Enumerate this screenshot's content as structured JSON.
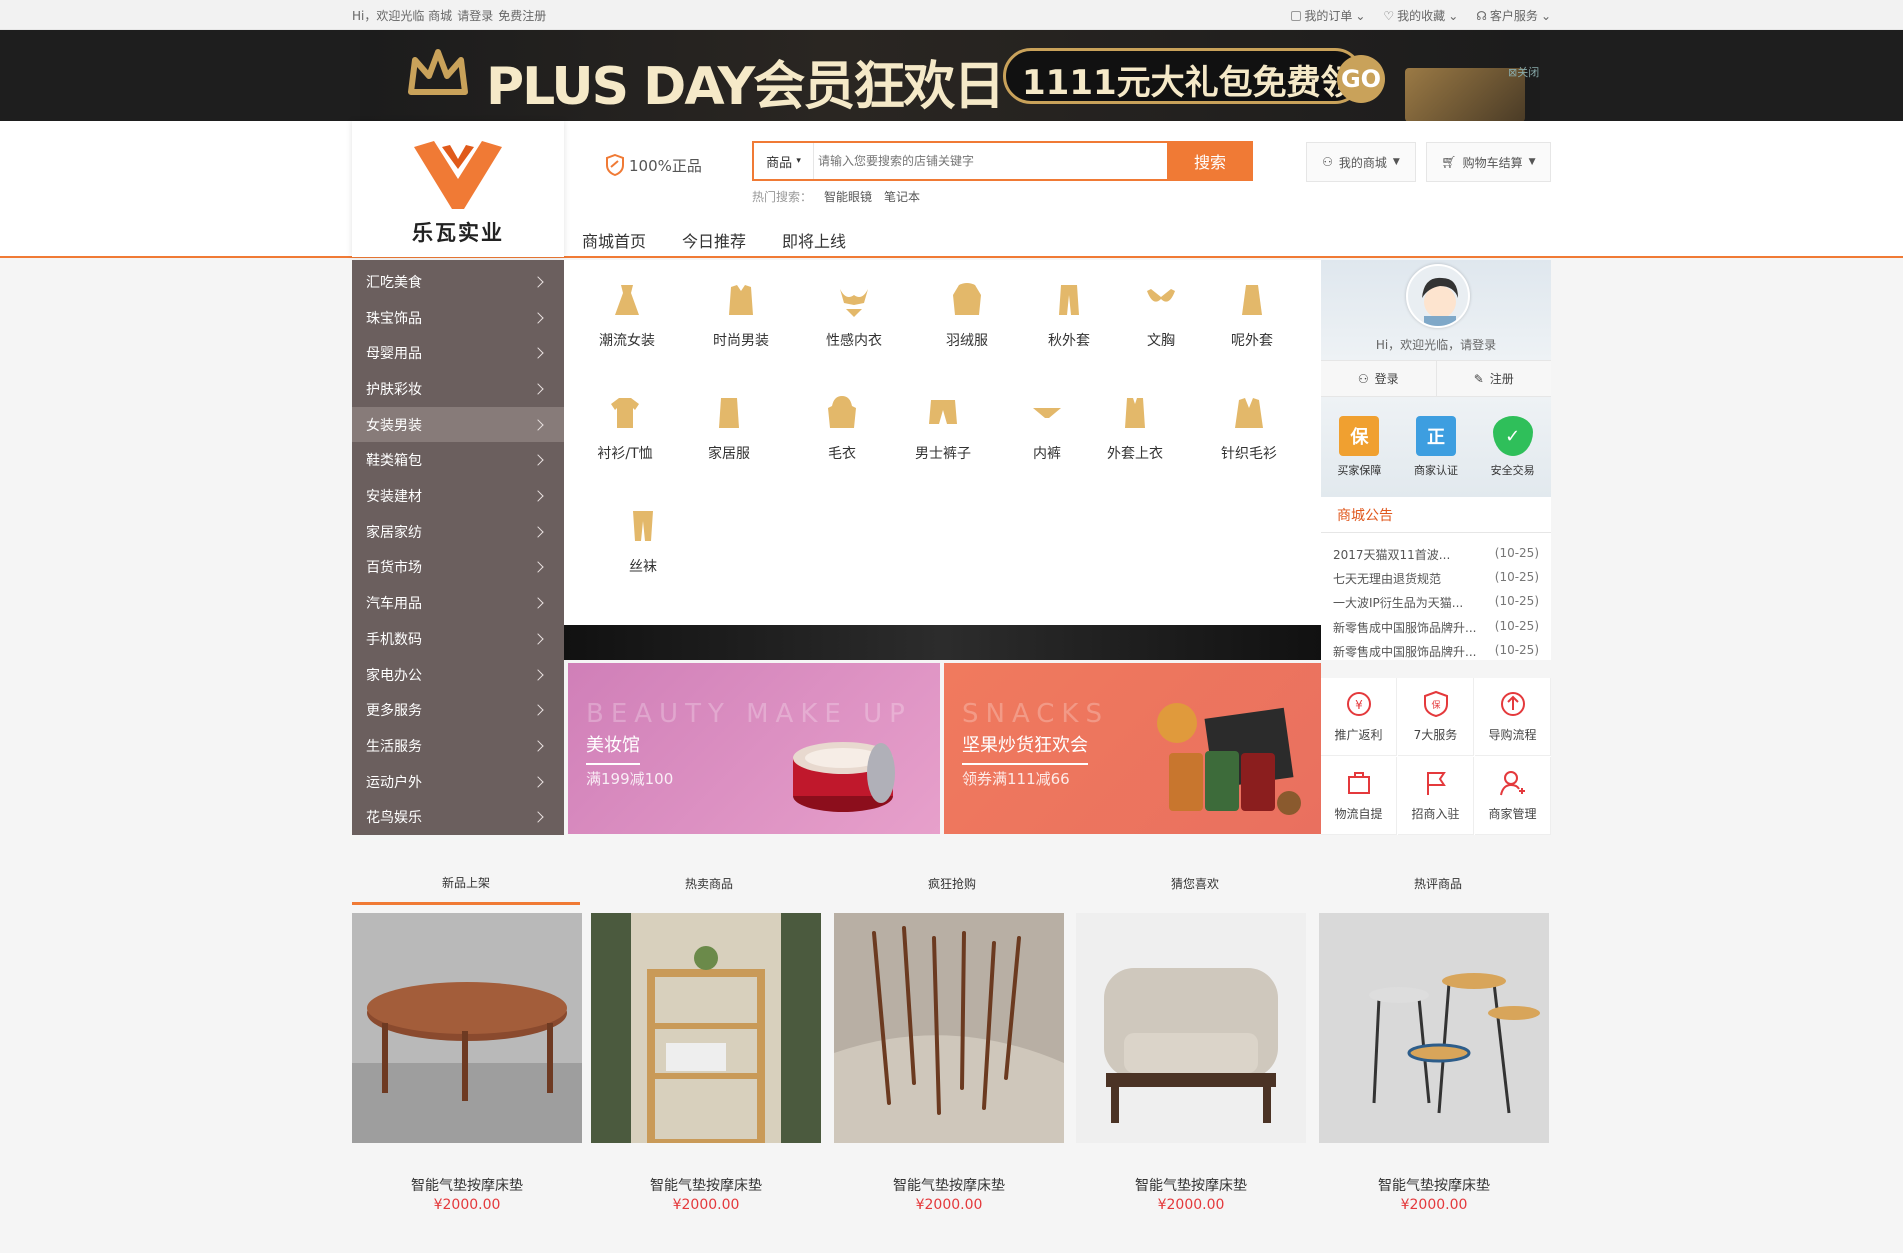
{
  "topbar": {
    "greeting": "Hi，欢迎光临 商城",
    "login": "请登录",
    "register": "免费注册",
    "my_orders": "我的订单",
    "my_favorites": "我的收藏",
    "customer_service": "客户服务"
  },
  "banner": {
    "headline": "PLUS DAY会员狂欢日",
    "offer": "1111元大礼包免费领",
    "go": "GO",
    "close": "关闭"
  },
  "logo": {
    "name": "乐瓦实业"
  },
  "header": {
    "genuine": "100%正品",
    "search_category": "商品",
    "search_placeholder": "请输入您要搜索的店铺关键字",
    "search_button": "搜索",
    "hot_label": "热门搜索：",
    "hot_keywords": [
      "智能眼镜",
      "笔记本"
    ],
    "my_mall": "我的商城",
    "cart": "购物车结算"
  },
  "main_nav": [
    "商城首页",
    "今日推荐",
    "即将上线"
  ],
  "categories": [
    "汇吃美食",
    "珠宝饰品",
    "母婴用品",
    "护肤彩妆",
    "女装男装",
    "鞋类箱包",
    "安装建材",
    "家居家纺",
    "百货市场",
    "汽车用品",
    "手机数码",
    "家电办公",
    "更多服务",
    "生活服务",
    "运动户外",
    "花鸟娱乐"
  ],
  "active_category": "女装男装",
  "sub_categories": [
    "潮流女装",
    "时尚男装",
    "性感内衣",
    "羽绒服",
    "秋外套",
    "文胸",
    "呢外套",
    "衬衫/T恤",
    "家居服",
    "毛衣",
    "男士裤子",
    "内裤",
    "外套上衣",
    "针织毛衫",
    "丝袜"
  ],
  "promos": [
    {
      "bg_text": "BEAUTY MAKE UP",
      "title": "美妆馆",
      "subtitle": "满199减100"
    },
    {
      "bg_text": "SNACKS",
      "title": "坚果炒货狂欢会",
      "subtitle": "领券满111减66"
    }
  ],
  "user_panel": {
    "greeting": "Hi，欢迎光临，请登录",
    "login": "登录",
    "register": "注册",
    "badges": [
      {
        "label": "买家保障",
        "glyph": "保",
        "color": "#f0a030"
      },
      {
        "label": "商家认证",
        "glyph": "正",
        "color": "#3d9ee0"
      },
      {
        "label": "安全交易",
        "glyph": "✓",
        "color": "#2fbf5a"
      }
    ]
  },
  "notice": {
    "title": "商城公告",
    "items": [
      {
        "text": "2017天猫双11首波...",
        "date": "(10-25)"
      },
      {
        "text": "七天无理由退货规范",
        "date": "(10-25)"
      },
      {
        "text": "一大波IP衍生品为天猫...",
        "date": "(10-25)"
      },
      {
        "text": "新零售成中国服饰品牌升...",
        "date": "(10-25)"
      },
      {
        "text": "新零售成中国服饰品牌升...",
        "date": "(10-25)"
      }
    ]
  },
  "services": [
    "推广返利",
    "7大服务",
    "导购流程",
    "物流自提",
    "招商入驻",
    "商家管理"
  ],
  "tabs": [
    "新品上架",
    "热卖商品",
    "疯狂抢购",
    "猜您喜欢",
    "热评商品"
  ],
  "active_tab": "新品上架",
  "products": [
    {
      "name": "智能气垫按摩床垫",
      "price": "¥2000.00"
    },
    {
      "name": "智能气垫按摩床垫",
      "price": "¥2000.00"
    },
    {
      "name": "智能气垫按摩床垫",
      "price": "¥2000.00"
    },
    {
      "name": "智能气垫按摩床垫",
      "price": "¥2000.00"
    },
    {
      "name": "智能气垫按摩床垫",
      "price": "¥2000.00"
    }
  ],
  "colors": {
    "accent": "#f07a35",
    "price": "#e4393c",
    "menu_bg": "#6b5f5e"
  }
}
